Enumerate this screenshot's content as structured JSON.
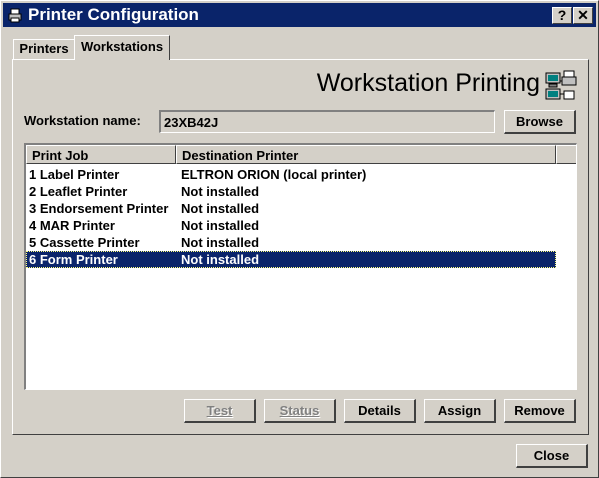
{
  "window": {
    "title": "Printer Configuration",
    "help_label": "?",
    "close_label": "✕"
  },
  "tabs": [
    {
      "label": "Printers",
      "active": false
    },
    {
      "label": "Workstations",
      "active": true
    }
  ],
  "panel": {
    "heading": "Workstation Printing",
    "heading_icon": "printer-network-icon",
    "workstation_label": "Workstation name:",
    "workstation_value": "23XB42J",
    "browse_label": "Browse"
  },
  "table": {
    "columns": [
      "Print Job",
      "Destination Printer"
    ],
    "rows": [
      {
        "job": "1 Label Printer",
        "dest": "ELTRON ORION (local printer)"
      },
      {
        "job": "2 Leaflet Printer",
        "dest": "Not installed"
      },
      {
        "job": "3 Endorsement Printer",
        "dest": "Not installed"
      },
      {
        "job": "4 MAR Printer",
        "dest": "Not installed"
      },
      {
        "job": "5 Cassette Printer",
        "dest": "Not installed"
      },
      {
        "job": "6 Form Printer",
        "dest": "Not installed"
      }
    ],
    "selected_row": 5
  },
  "actions": {
    "test_label": "Test",
    "status_label": "Status",
    "details_label": "Details",
    "assign_label": "Assign",
    "remove_label": "Remove"
  },
  "footer": {
    "close_label": "Close"
  },
  "colors": {
    "titlebar": "#0a246a",
    "selection": "#0a246a",
    "face": "#d4d0c8"
  }
}
